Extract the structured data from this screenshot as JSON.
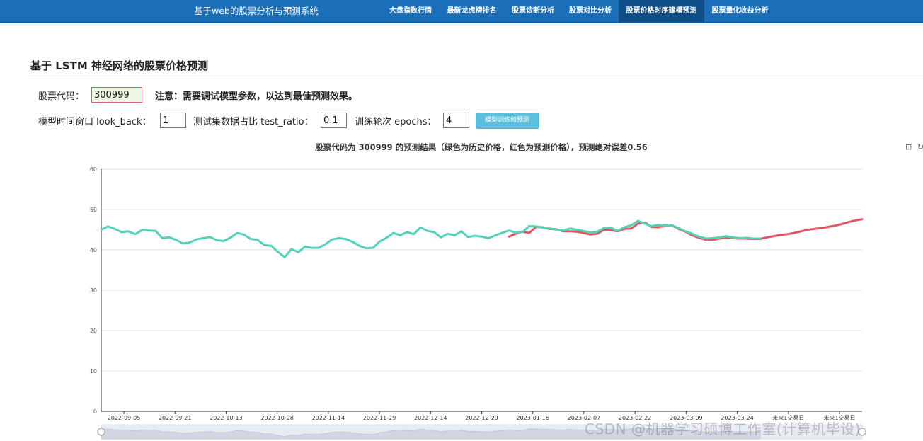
{
  "navbar": {
    "brand": "基于web的股票分析与预测系统",
    "items": [
      {
        "label": "大盘指数行情",
        "active": false
      },
      {
        "label": "最新龙虎榜排名",
        "active": false
      },
      {
        "label": "股票诊断分析",
        "active": false
      },
      {
        "label": "股票对比分析",
        "active": false
      },
      {
        "label": "股票价格时序建模预测",
        "active": true
      },
      {
        "label": "股票量化收益分析",
        "active": false
      }
    ],
    "color": "#1b6fb8"
  },
  "page": {
    "title": "基于 LSTM 神经网络的股票价格预测",
    "code_label": "股票代码：",
    "code_value": "300999",
    "note": "注意：需要调试模型参数，以达到最佳预测效果。",
    "look_back_label": "模型时间窗口 look_back：",
    "look_back_value": "1",
    "test_ratio_label": "测试集数据占比 test_ratio：",
    "test_ratio_value": "0.1",
    "epochs_label": "训练轮次 epochs：",
    "epochs_value": "4",
    "train_button": "模型训练和预测"
  },
  "toolbox": {
    "icons": [
      "data-zoom-icon",
      "restore-icon"
    ]
  },
  "watermark": "CSDN @机器学习硕博工作室(计算机毕设)",
  "chart_data": {
    "type": "line",
    "title": "股票代码为 300999 的预测结果（绿色为历史价格，红色为预测价格），预测绝对误差0.56",
    "ylim": [
      0,
      60
    ],
    "yticks": [
      0,
      10,
      20,
      30,
      40,
      50,
      60
    ],
    "xtick_labels": [
      "2022-09-05",
      "2022-09-21",
      "2022-10-13",
      "2022-10-28",
      "2022-11-14",
      "2022-11-29",
      "2022-12-14",
      "2022-12-29",
      "2023-01-16",
      "2023-02-07",
      "2023-02-22",
      "2023-03-09",
      "2023-03-24",
      "未来1交易日",
      "未来1交易日"
    ],
    "grid": true,
    "datazoom": true,
    "series": [
      {
        "color": "#52d3b8",
        "points": [
          [
            0,
            45
          ],
          [
            1,
            45.8
          ],
          [
            2,
            45.2
          ],
          [
            3,
            44.4
          ],
          [
            4,
            44.6
          ],
          [
            5,
            43.9
          ],
          [
            6,
            44.9
          ],
          [
            7,
            44.8
          ],
          [
            8,
            44.7
          ],
          [
            9,
            42.9
          ],
          [
            10,
            43.1
          ],
          [
            11,
            42.5
          ],
          [
            12,
            41.6
          ],
          [
            13,
            41.8
          ],
          [
            14,
            42.6
          ],
          [
            15,
            42.9
          ],
          [
            16,
            43.2
          ],
          [
            17,
            42.4
          ],
          [
            18,
            42.2
          ],
          [
            19,
            43.0
          ],
          [
            20,
            44.2
          ],
          [
            21,
            43.8
          ],
          [
            22,
            42.7
          ],
          [
            23,
            42.5
          ],
          [
            24,
            41.2
          ],
          [
            25,
            41.0
          ],
          [
            26,
            39.5
          ],
          [
            27,
            38.2
          ],
          [
            28,
            40.2
          ],
          [
            29,
            39.4
          ],
          [
            30,
            40.8
          ],
          [
            31,
            40.5
          ],
          [
            32,
            40.5
          ],
          [
            33,
            41.4
          ],
          [
            34,
            42.6
          ],
          [
            35,
            42.9
          ],
          [
            36,
            42.7
          ],
          [
            37,
            42.0
          ],
          [
            38,
            41.0
          ],
          [
            39,
            40.4
          ],
          [
            40,
            40.5
          ],
          [
            41,
            42.1
          ],
          [
            42,
            43.0
          ],
          [
            43,
            44.2
          ],
          [
            44,
            43.6
          ],
          [
            45,
            44.4
          ],
          [
            46,
            43.9
          ],
          [
            47,
            45.6
          ],
          [
            48,
            44.7
          ],
          [
            49,
            44.4
          ],
          [
            50,
            43.1
          ],
          [
            51,
            44.0
          ],
          [
            52,
            43.6
          ],
          [
            53,
            44.6
          ],
          [
            54,
            43.2
          ],
          [
            55,
            43.5
          ],
          [
            56,
            43.3
          ],
          [
            57,
            42.9
          ],
          [
            58,
            43.6
          ],
          [
            59,
            44.2
          ],
          [
            60,
            44.8
          ],
          [
            61,
            44.3
          ],
          [
            62,
            44.4
          ],
          [
            63,
            45.9
          ],
          [
            64,
            45.8
          ],
          [
            65,
            45.5
          ],
          [
            66,
            45.3
          ],
          [
            67,
            45.0
          ],
          [
            68,
            44.8
          ],
          [
            69,
            45.3
          ],
          [
            70,
            45.0
          ],
          [
            71,
            44.7
          ],
          [
            72,
            44.3
          ],
          [
            73,
            44.5
          ],
          [
            74,
            45.4
          ],
          [
            75,
            45.5
          ],
          [
            76,
            44.7
          ],
          [
            77,
            45.6
          ],
          [
            78,
            46.1
          ],
          [
            79,
            47.2
          ],
          [
            80,
            46.5
          ],
          [
            81,
            45.9
          ],
          [
            82,
            46.2
          ],
          [
            83,
            46.0
          ],
          [
            84,
            46.1
          ],
          [
            85,
            45.4
          ],
          [
            86,
            44.6
          ],
          [
            87,
            44.0
          ],
          [
            88,
            43.3
          ],
          [
            89,
            42.8
          ],
          [
            90,
            42.9
          ],
          [
            91,
            43.1
          ],
          [
            92,
            43.4
          ],
          [
            93,
            43.1
          ],
          [
            94,
            42.9
          ],
          [
            95,
            43.0
          ],
          [
            96,
            42.8
          ],
          [
            97,
            42.8
          ]
        ]
      },
      {
        "color": "#e05561",
        "points": [
          [
            60,
            43.3
          ],
          [
            61,
            44.0
          ],
          [
            62,
            44.5
          ],
          [
            63,
            44.2
          ],
          [
            64,
            45.7
          ],
          [
            65,
            45.6
          ],
          [
            66,
            45.2
          ],
          [
            67,
            45.1
          ],
          [
            68,
            44.6
          ],
          [
            69,
            44.6
          ],
          [
            70,
            44.5
          ],
          [
            71,
            44.2
          ],
          [
            72,
            43.8
          ],
          [
            73,
            44.0
          ],
          [
            74,
            45.0
          ],
          [
            75,
            44.9
          ],
          [
            76,
            44.6
          ],
          [
            77,
            45.2
          ],
          [
            78,
            45.3
          ],
          [
            79,
            46.5
          ],
          [
            80,
            46.8
          ],
          [
            81,
            45.7
          ],
          [
            82,
            45.6
          ],
          [
            83,
            46.0
          ],
          [
            84,
            46.1
          ],
          [
            85,
            45.2
          ],
          [
            86,
            44.5
          ],
          [
            87,
            43.6
          ],
          [
            88,
            43.0
          ],
          [
            89,
            42.5
          ],
          [
            90,
            42.5
          ],
          [
            91,
            42.8
          ],
          [
            92,
            43.0
          ],
          [
            93,
            42.9
          ],
          [
            94,
            42.8
          ],
          [
            95,
            42.8
          ],
          [
            96,
            42.7
          ],
          [
            97,
            42.7
          ],
          [
            98,
            43.1
          ],
          [
            99,
            43.4
          ],
          [
            100,
            43.7
          ],
          [
            101,
            43.9
          ],
          [
            102,
            44.2
          ],
          [
            103,
            44.6
          ],
          [
            104,
            45.0
          ],
          [
            105,
            45.2
          ],
          [
            106,
            45.4
          ],
          [
            107,
            45.7
          ],
          [
            108,
            46.0
          ],
          [
            109,
            46.4
          ],
          [
            110,
            46.9
          ],
          [
            111,
            47.3
          ],
          [
            112,
            47.6
          ]
        ]
      }
    ]
  }
}
